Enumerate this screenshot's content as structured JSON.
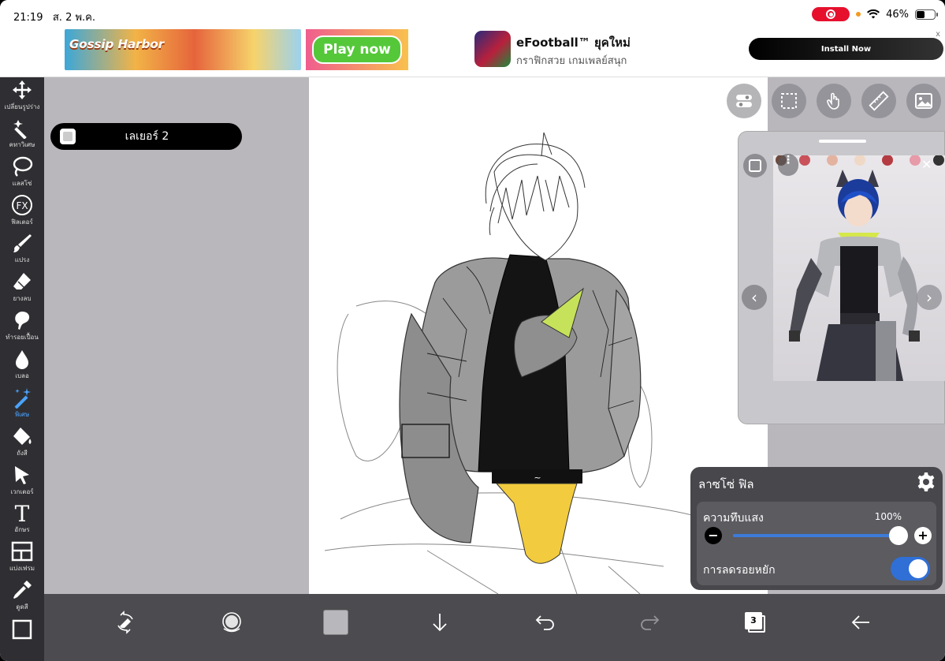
{
  "status": {
    "time": "21:19",
    "date": "ส. 2 พ.ค.",
    "battery": "46%",
    "battery_level": 0.46
  },
  "ad": {
    "game1_logo": "Gossip Harbor",
    "play_label": "Play now",
    "title": "eFootball™ ยุคใหม่",
    "subtitle": "กราฟิกสวย เกมเพลย์สนุก",
    "install_label": "Install Now",
    "close_label": "x"
  },
  "toolbar": {
    "items": [
      {
        "label": "เปลี่ยนรูปร่าง",
        "icon": "move-icon"
      },
      {
        "label": "คทาวิเศษ",
        "icon": "magic-wand-icon"
      },
      {
        "label": "แลสโซ่",
        "icon": "lasso-icon"
      },
      {
        "label": "ฟิลเตอร์",
        "icon": "fx-icon"
      },
      {
        "label": "แปรง",
        "icon": "brush-icon"
      },
      {
        "label": "ยางลบ",
        "icon": "eraser-icon"
      },
      {
        "label": "ทำรอยเปื้อน",
        "icon": "smudge-icon"
      },
      {
        "label": "เบลอ",
        "icon": "blur-icon"
      },
      {
        "label": "พิเศษ",
        "icon": "special-icon"
      },
      {
        "label": "ถังสี",
        "icon": "bucket-icon"
      },
      {
        "label": "เวกเตอร์",
        "icon": "vector-icon"
      },
      {
        "label": "อักษร",
        "icon": "text-icon"
      },
      {
        "label": "แบ่งเฟรม",
        "icon": "frame-divider-icon"
      },
      {
        "label": "ดูดสี",
        "icon": "eyedropper-icon"
      },
      {
        "label": "",
        "icon": "canvas-icon"
      }
    ],
    "fx_glyph": "FX",
    "text_glyph": "T"
  },
  "layer": {
    "name": "เลเยอร์ 2"
  },
  "fill_panel": {
    "title": "ลาซโซ่ ฟิล",
    "opacity_label": "ความทึบแสง",
    "opacity_value": "100%",
    "opacity_level": 1.0,
    "minus": "−",
    "plus": "+",
    "antialias_label": "การลดรอยหยัก",
    "antialias_on": true
  },
  "reference": {
    "menu": "⋮",
    "prev": "‹",
    "next": "›",
    "close": "✕"
  },
  "bottom": {
    "layers_count": "3"
  },
  "colors": {
    "toolbar_bg": "#2f2f33",
    "panel_gray": "#b9b7bc",
    "bottombar": "#4c4c50",
    "accent_blue": "#3d7bd8",
    "recording_red": "#e6102d"
  }
}
